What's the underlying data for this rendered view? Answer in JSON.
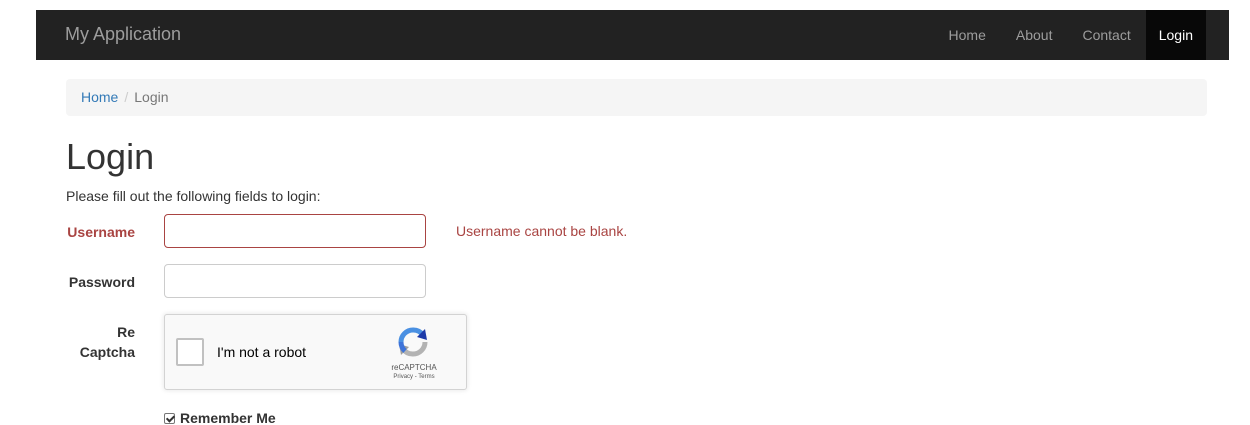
{
  "navbar": {
    "brand": "My Application",
    "items": [
      {
        "label": "Home",
        "active": false
      },
      {
        "label": "About",
        "active": false
      },
      {
        "label": "Contact",
        "active": false
      },
      {
        "label": "Login",
        "active": true
      }
    ]
  },
  "breadcrumb": {
    "home": "Home",
    "separator": "/",
    "current": "Login"
  },
  "page": {
    "title": "Login",
    "lead": "Please fill out the following fields to login:"
  },
  "form": {
    "username": {
      "label": "Username",
      "value": "",
      "error": "Username cannot be blank."
    },
    "password": {
      "label": "Password",
      "value": ""
    },
    "recaptcha": {
      "label_line1": "Re",
      "label_line2": "Captcha",
      "checkbox_text": "I'm not a robot",
      "brand": "reCAPTCHA",
      "terms": "Privacy - Terms",
      "checked": false
    },
    "remember_me": {
      "label": "Remember Me",
      "checked": true
    }
  },
  "colors": {
    "navbar_bg": "#222222",
    "navbar_active_bg": "#080808",
    "link": "#337ab7",
    "error": "#a94442"
  }
}
